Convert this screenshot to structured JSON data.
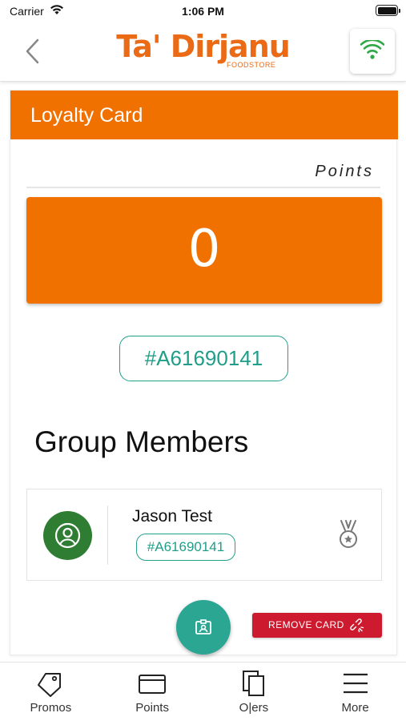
{
  "status_bar": {
    "carrier": "Carrier",
    "time": "1:06 PM"
  },
  "header": {
    "brand_name": "Ta' Dirjanu",
    "brand_sub": "FOODSTORE",
    "back_icon": "chevron-left-icon",
    "wifi_icon": "wifi-icon"
  },
  "loyalty": {
    "title": "Loyalty Card",
    "points_label": "Points",
    "points_value": "0",
    "card_number": "#A61690141"
  },
  "group": {
    "title": "Group Members",
    "members": [
      {
        "name": "Jason Test",
        "number": "#A61690141",
        "avatar_icon": "user-icon",
        "badge_icon": "medal-icon"
      }
    ]
  },
  "actions": {
    "fab_icon": "id-card-icon",
    "remove_card_label": "REMOVE CARD",
    "remove_card_icon": "unlink-icon"
  },
  "tabs": [
    {
      "label": "Promos",
      "icon": "tag-icon"
    },
    {
      "label": "Points",
      "icon": "card-icon"
    },
    {
      "label": "O|ers",
      "icon": "copy-icon"
    },
    {
      "label": "More",
      "icon": "menu-icon"
    }
  ],
  "colors": {
    "brand_orange": "#f07000",
    "teal": "#1f9e89",
    "member_green": "#2e7d32",
    "remove_red": "#cd1a2e"
  }
}
